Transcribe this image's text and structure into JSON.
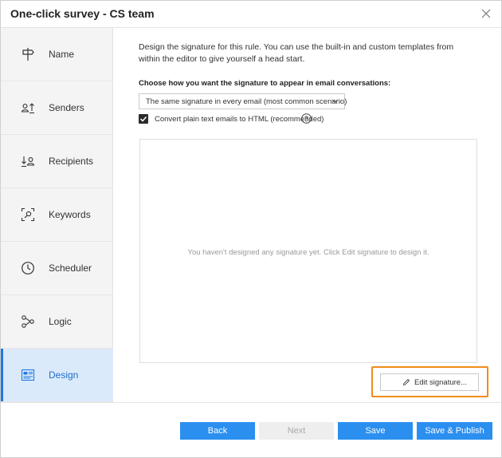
{
  "dialog": {
    "title": "One-click survey - CS team",
    "close_icon": "close-icon"
  },
  "sidebar": {
    "items": [
      {
        "label": "Name",
        "icon": "signpost-icon",
        "active": false
      },
      {
        "label": "Senders",
        "icon": "senders-icon",
        "active": false
      },
      {
        "label": "Recipients",
        "icon": "recipients-icon",
        "active": false
      },
      {
        "label": "Keywords",
        "icon": "keywords-icon",
        "active": false
      },
      {
        "label": "Scheduler",
        "icon": "clock-icon",
        "active": false
      },
      {
        "label": "Logic",
        "icon": "logic-icon",
        "active": false
      },
      {
        "label": "Design",
        "icon": "design-icon",
        "active": true
      }
    ]
  },
  "main": {
    "intro": "Design the signature for this rule. You can use the built-in and custom templates from within the editor to give yourself a head start.",
    "choose_label": "Choose how you want the signature to appear in email conversations:",
    "mode_select": {
      "value": "The same signature in every email (most common scenario)"
    },
    "convert_checkbox": {
      "label": "Convert plain text emails to HTML (recommended)",
      "checked": true
    },
    "preview_empty_message": "You haven't designed any signature yet. Click Edit signature to design it.",
    "edit_button_label": "Edit signature..."
  },
  "footer": {
    "back_label": "Back",
    "next_label": "Next",
    "save_label": "Save",
    "save_publish_label": "Save & Publish"
  },
  "colors": {
    "accent": "#2b8ff0",
    "active_nav_bg": "#dbeafb",
    "highlight": "#f08c1a"
  }
}
